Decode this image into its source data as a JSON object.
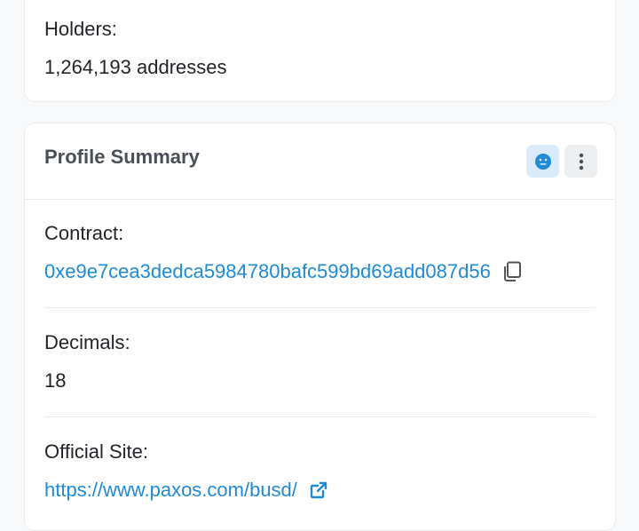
{
  "holders": {
    "label": "Holders:",
    "value": "1,264,193 addresses"
  },
  "profile": {
    "title": "Profile Summary",
    "icons": [
      "smiley-icon",
      "more-vertical-icon"
    ],
    "contract": {
      "label": "Contract:",
      "address": "0xe9e7cea3dedca5984780bafc599bd69add087d56",
      "icon": "copy-icon"
    },
    "decimals": {
      "label": "Decimals:",
      "value": "18"
    },
    "official_site": {
      "label": "Official Site:",
      "url": "https://www.paxos.com/busd/",
      "icon": "external-link-icon"
    }
  },
  "colors": {
    "link": "#1f8ad6",
    "accent_bg": "#dbeaf8",
    "button_bg": "#eceef0"
  }
}
